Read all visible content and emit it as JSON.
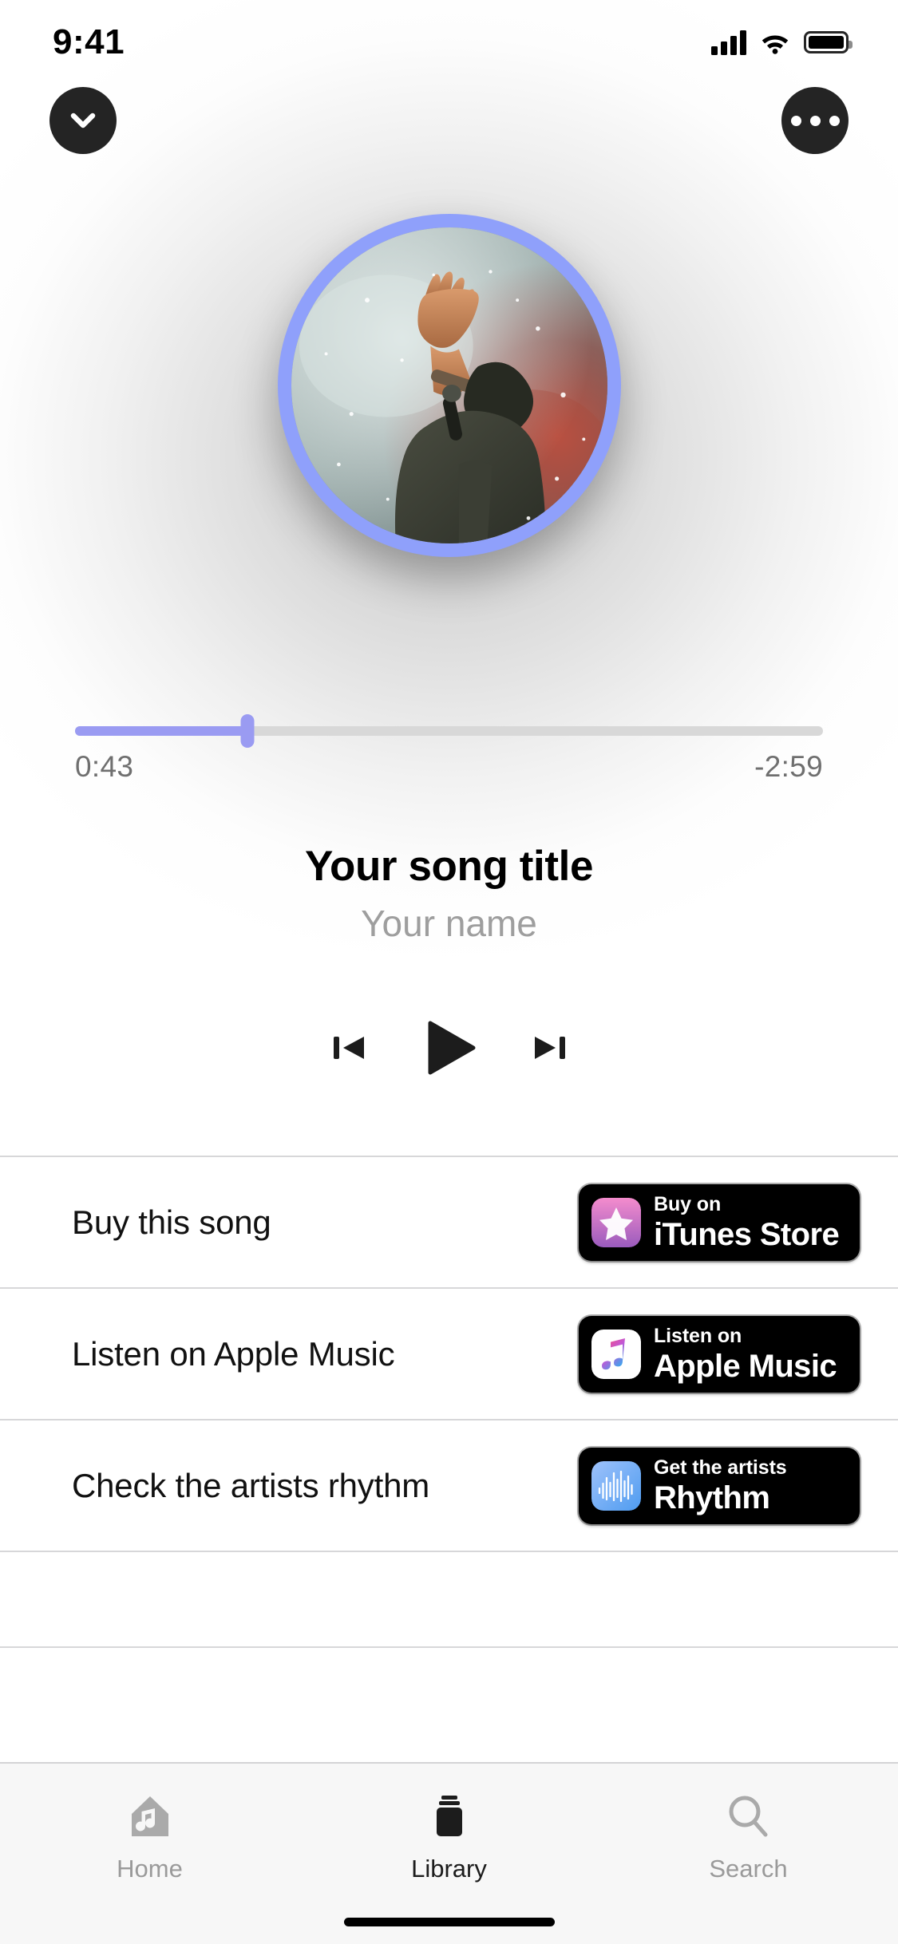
{
  "status_bar": {
    "time": "9:41",
    "signal_icon": "cellular-signal-icon",
    "wifi_icon": "wifi-icon",
    "battery_icon": "battery-icon"
  },
  "header": {
    "collapse_icon": "chevron-down-icon",
    "more_icon": "more-options-icon"
  },
  "artwork": {
    "name": "album-artwork",
    "ring_color": "#8fa0fb",
    "description": "Performer with raised arm in smoke"
  },
  "playback": {
    "elapsed": "0:43",
    "remaining": "-2:59",
    "progress_percent": 23,
    "fill_color": "#9a9bf2",
    "track_color": "#d8d8d8",
    "title": "Your song title",
    "artist": "Your name",
    "previous_icon": "previous-track-icon",
    "play_icon": "play-icon",
    "next_icon": "next-track-icon"
  },
  "links": [
    {
      "label": "Buy this song",
      "badge": {
        "sub": "Buy on",
        "main": "iTunes Store",
        "icon": "itunes-store-icon",
        "icon_colors": [
          "#f081c4",
          "#a05ec0"
        ]
      }
    },
    {
      "label": "Listen on Apple Music",
      "badge": {
        "sub": "Listen on",
        "main": "Apple Music",
        "icon": "apple-music-icon",
        "icon_colors": [
          "#fa5c7a",
          "#29b6f6"
        ]
      }
    },
    {
      "label": "Check the artists rhythm",
      "badge": {
        "sub": "Get the artists",
        "main": "Rhythm",
        "icon": "rhythm-waveform-icon",
        "icon_colors": [
          "#8ab4f8",
          "#5aa9f5"
        ]
      }
    }
  ],
  "tabs": [
    {
      "label": "Home",
      "icon": "home-music-icon",
      "active": false
    },
    {
      "label": "Library",
      "icon": "library-icon",
      "active": true
    },
    {
      "label": "Search",
      "icon": "search-icon",
      "active": false
    }
  ]
}
